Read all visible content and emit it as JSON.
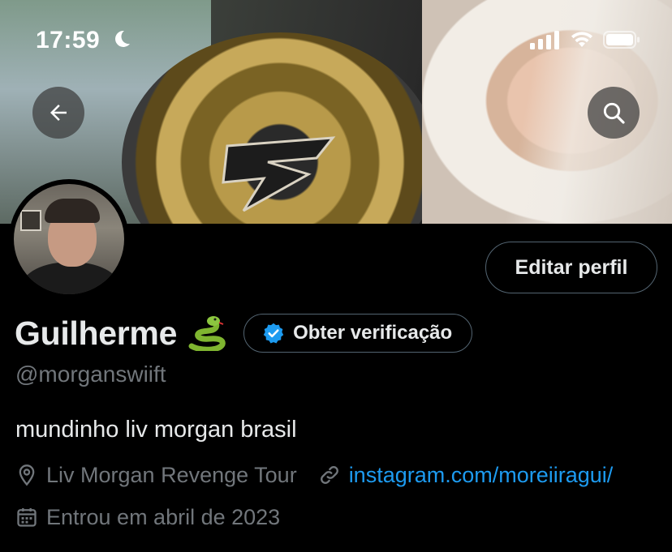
{
  "status_bar": {
    "time": "17:59",
    "moon_icon": "moon-icon",
    "signal_icon": "cellular-signal-icon",
    "wifi_icon": "wifi-icon",
    "battery_icon": "battery-icon"
  },
  "header": {
    "back_icon": "arrow-left-icon",
    "search_icon": "search-icon"
  },
  "profile": {
    "edit_button": "Editar perfil",
    "name": "Guilherme",
    "name_emoji": "snake-emoji",
    "verify_button": "Obter verificação",
    "handle": "@morganswiift",
    "bio": "mundinho liv morgan brasil",
    "location": "Liv Morgan Revenge Tour",
    "website": "instagram.com/moreiiragui/",
    "joined": "Entrou em abril de 2023"
  },
  "colors": {
    "background": "#000000",
    "text_primary": "#e7e9ea",
    "text_muted": "#71767b",
    "link": "#1d9bf0",
    "border": "#536471",
    "verified_blue": "#1d9bf0"
  }
}
